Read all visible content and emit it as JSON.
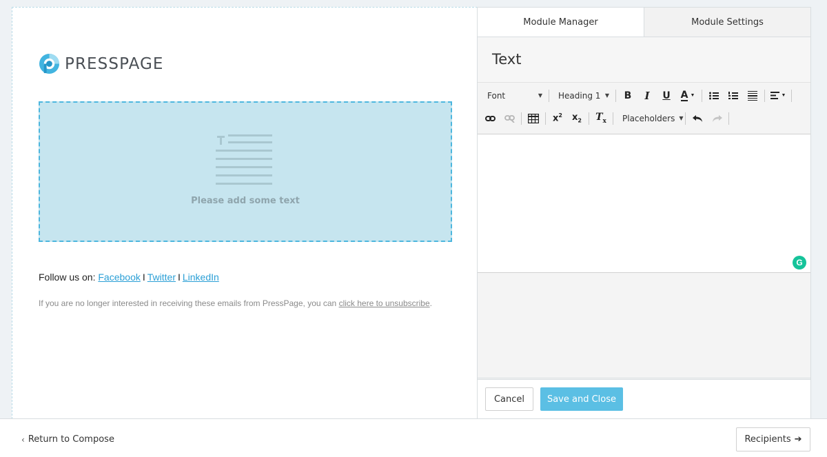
{
  "email": {
    "logo_text": "PRESSPAGE",
    "placeholder_text": "Please add some text",
    "follow_prefix": "Follow us on:",
    "social_links": [
      "Facebook",
      "Twitter",
      "LinkedIn"
    ],
    "separator": "I",
    "unsubscribe_prefix": "If you are no longer interested in receiving these emails from PressPage, you can",
    "unsubscribe_link": "click here to unsubscribe",
    "unsubscribe_suffix": "."
  },
  "panel": {
    "tabs": [
      {
        "label": "Module Manager",
        "active": true
      },
      {
        "label": "Module Settings",
        "active": false
      }
    ],
    "title": "Text",
    "toolbar": {
      "font_label": "Font",
      "heading_label": "Heading 1",
      "bold": "B",
      "italic": "I",
      "underline": "U",
      "text_color": "A",
      "placeholders_label": "Placeholders"
    },
    "grammarly": "G",
    "cancel_label": "Cancel",
    "save_label": "Save and Close"
  },
  "footer": {
    "return_label": "Return to Compose",
    "recipients_label": "Recipients"
  },
  "colors": {
    "accent": "#5bbfe4",
    "link": "#2a9fd6",
    "placeholder_bg": "#c6e5ef",
    "placeholder_border": "#4cb6de",
    "grammarly": "#15c39a"
  },
  "icons": {
    "logo": "presspage-logo-icon",
    "text_block": "text-block-icon",
    "grammarly": "grammarly-icon"
  }
}
